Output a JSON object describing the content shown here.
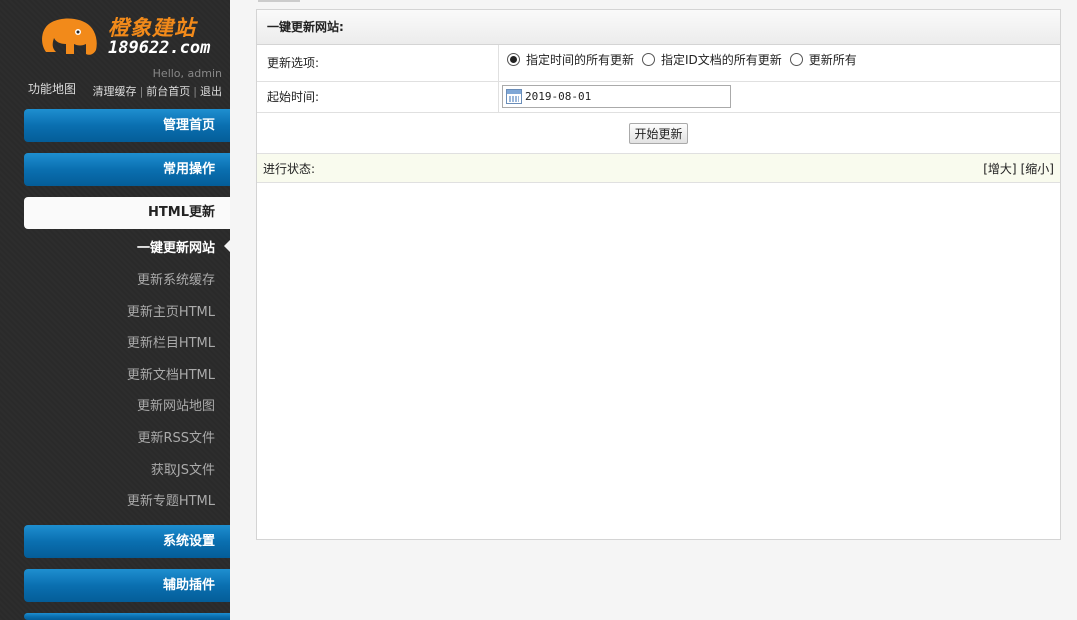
{
  "sidebar": {
    "logo_cn": "橙象建站",
    "logo_en": "189622.com",
    "hello": "Hello, admin",
    "sitemap_label": "功能地图",
    "links": {
      "clear_cache": "清理缓存",
      "front_home": "前台首页",
      "logout": "退出"
    },
    "menus": {
      "manage_home": "管理首页",
      "common_ops": "常用操作",
      "html_update": "HTML更新",
      "system_settings": "系统设置",
      "plugins": "辅助插件"
    },
    "sub_items": [
      {
        "label": "一键更新网站",
        "current": true
      },
      {
        "label": "更新系统缓存",
        "current": false
      },
      {
        "label": "更新主页HTML",
        "current": false
      },
      {
        "label": "更新栏目HTML",
        "current": false
      },
      {
        "label": "更新文档HTML",
        "current": false
      },
      {
        "label": "更新网站地图",
        "current": false
      },
      {
        "label": "更新RSS文件",
        "current": false
      },
      {
        "label": "获取JS文件",
        "current": false
      },
      {
        "label": "更新专题HTML",
        "current": false
      }
    ]
  },
  "panel": {
    "title": "一键更新网站:",
    "options_label": "更新选项:",
    "options": [
      {
        "label": "指定时间的所有更新",
        "checked": true
      },
      {
        "label": "指定ID文档的所有更新",
        "checked": false
      },
      {
        "label": "更新所有",
        "checked": false
      }
    ],
    "start_time_label": "起始时间:",
    "start_time_value": "2019-08-01",
    "start_button": "开始更新",
    "status_label": "进行状态:",
    "enlarge": "[增大]",
    "shrink": "[缩小]"
  },
  "colors": {
    "menu_blue": "#0a6fb0",
    "sidebar_bg": "#2a2a2a",
    "logo_orange": "#f28a1a",
    "status_bg": "#f9fbee"
  }
}
